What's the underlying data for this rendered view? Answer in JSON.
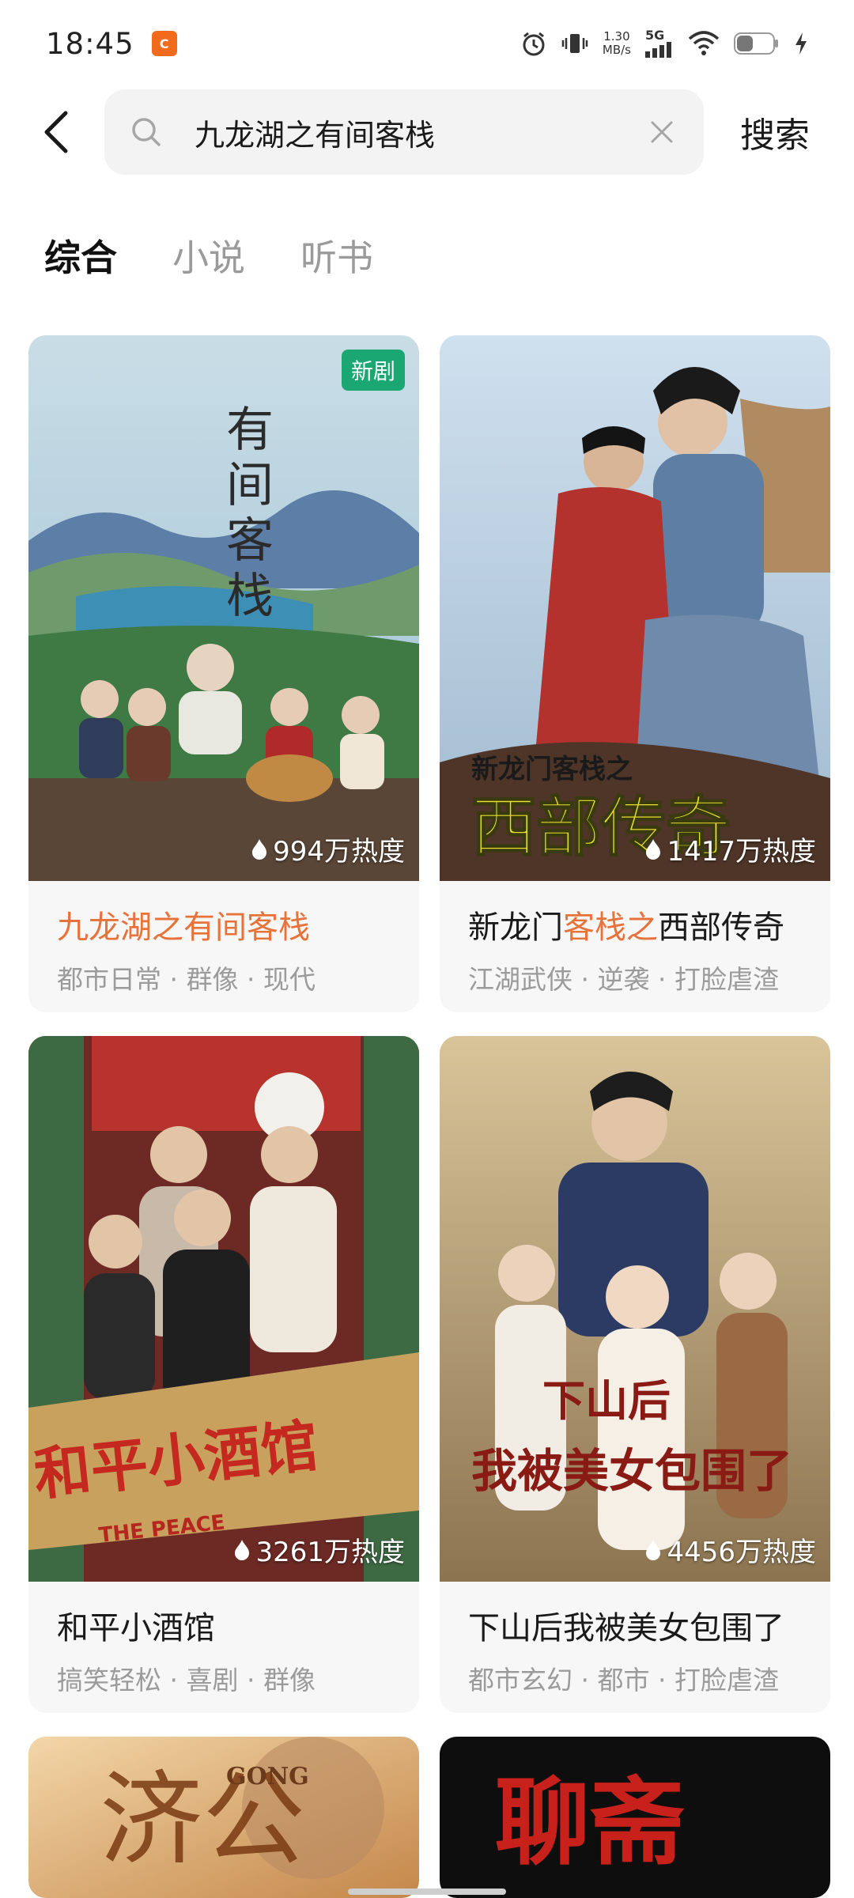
{
  "status_bar": {
    "time": "18:45",
    "app_icon": "app-notification-icon",
    "net_speed_value": "1.30",
    "net_speed_unit": "MB/s",
    "network": "5G",
    "icons": [
      "alarm-icon",
      "vibrate-icon",
      "signal-icon",
      "wifi-icon",
      "battery-icon",
      "charging-icon"
    ]
  },
  "search": {
    "query": "九龙湖之有间客栈",
    "submit_label": "搜索"
  },
  "tabs": [
    {
      "label": "综合",
      "active": true
    },
    {
      "label": "小说",
      "active": false
    },
    {
      "label": "听书",
      "active": false
    }
  ],
  "results": [
    {
      "title_parts": [
        "九龙湖之有间客栈"
      ],
      "tags": "都市日常 · 群像 · 现代",
      "heat": "994万热度",
      "badge": "新剧",
      "poster_text": "有间客栈"
    },
    {
      "title_parts": [
        "新龙门",
        "客栈之",
        "西部传奇"
      ],
      "tags": "江湖武侠 · 逆袭 · 打脸虐渣",
      "heat": "1417万热度",
      "poster_text_small": "新龙门客栈之",
      "poster_text": "西部传奇"
    },
    {
      "title_parts": [
        "和平小酒馆"
      ],
      "tags": "搞笑轻松 · 喜剧 · 群像",
      "heat": "3261万热度",
      "poster_text": "和平小酒馆",
      "poster_text_small": "THE PEACE"
    },
    {
      "title_parts": [
        "下山后我被美女包围了"
      ],
      "tags": "都市玄幻 · 都市 · 打脸虐渣",
      "heat": "4456万热度",
      "poster_text": "下山后我被美女包围了"
    },
    {
      "poster_text": "济公",
      "poster_text_small": "GONG"
    },
    {
      "poster_text": "聊斋"
    }
  ],
  "colors": {
    "highlight": "#e8733a",
    "badge": "#1ba772"
  }
}
